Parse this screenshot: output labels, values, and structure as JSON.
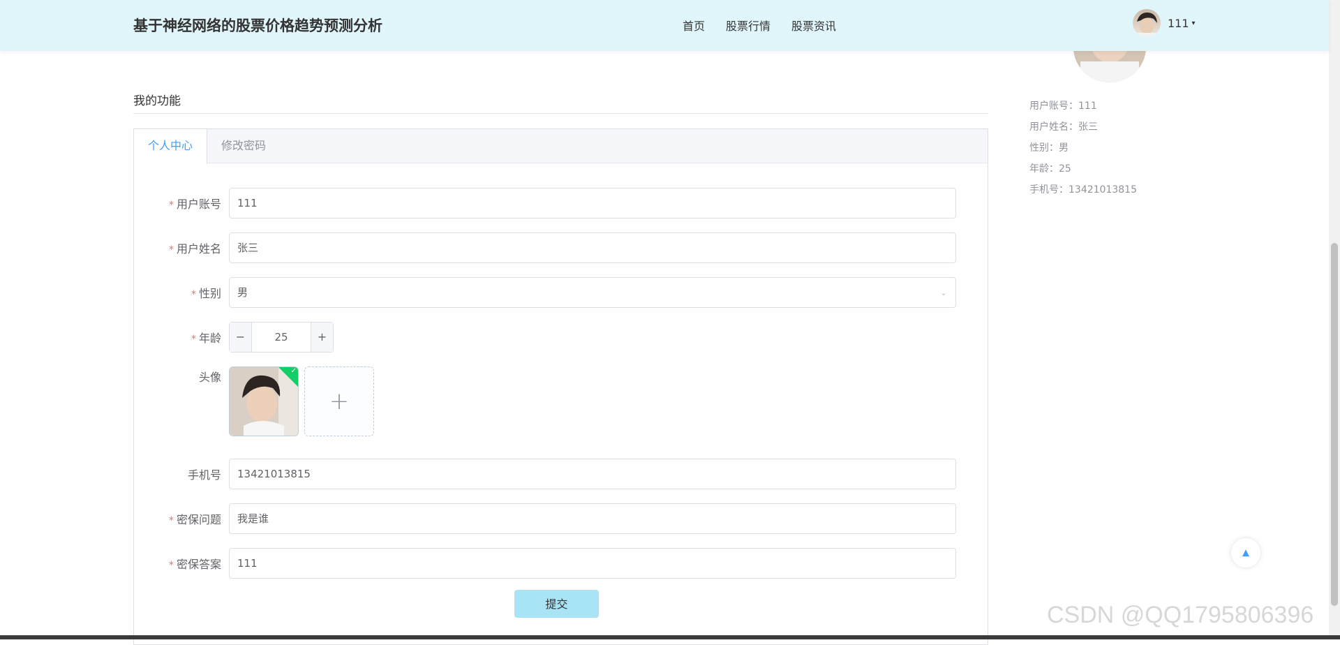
{
  "header": {
    "site_title": "基于神经网络的股票价格趋势预测分析",
    "nav": [
      "首页",
      "股票行情",
      "股票资讯"
    ],
    "user_name": "111",
    "caret": "▾"
  },
  "profile": {
    "rows": [
      "用户账号：111",
      "用户姓名：张三",
      "性别：男",
      "年龄：25",
      "手机号：13421013815"
    ]
  },
  "section_title": "我的功能",
  "tabs": [
    "个人中心",
    "修改密码"
  ],
  "form": {
    "required_mark": "*",
    "account": {
      "label": "用户账号",
      "value": "111"
    },
    "name": {
      "label": "用户姓名",
      "value": "张三"
    },
    "gender": {
      "label": "性别",
      "value": "男"
    },
    "age": {
      "label": "年龄",
      "value": "25",
      "minus": "−",
      "plus": "+"
    },
    "avatar": {
      "label": "头像"
    },
    "phone": {
      "label": "手机号",
      "value": "13421013815"
    },
    "question": {
      "label": "密保问题",
      "value": "我是谁"
    },
    "answer": {
      "label": "密保答案",
      "value": "111"
    },
    "submit": "提交"
  },
  "watermark": "CSDN @QQ1795806396",
  "icons": {
    "chevron": "⌄",
    "check": "✓",
    "plus": "+",
    "back_top": "▲"
  },
  "colors": {
    "header_bg": "#e1f6fb",
    "active_tab": "#409eff",
    "submit_bg": "#a8e4f5",
    "required": "#f56c6c"
  }
}
